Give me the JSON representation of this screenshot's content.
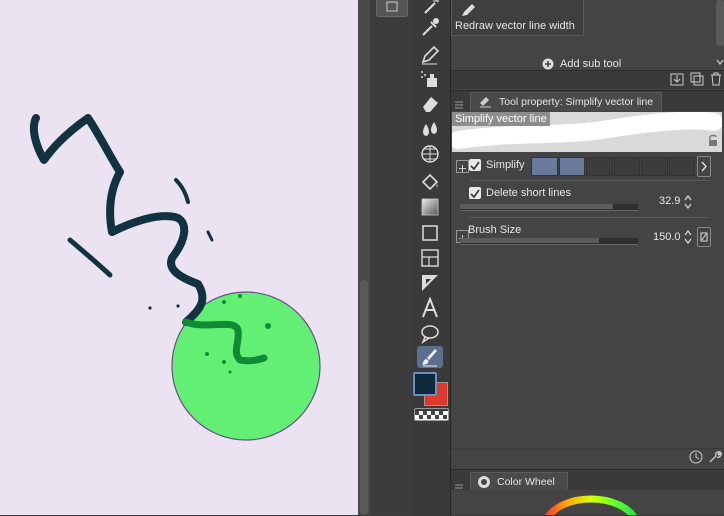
{
  "subtool": {
    "item_label": "Redraw vector line width",
    "add_label": "Add sub tool"
  },
  "tool_property": {
    "title": "Tool property: Simplify vector line",
    "preview_label": "Simplify vector line",
    "simplify": {
      "label": "Simplify",
      "segments_total": 6,
      "segments_filled": 2
    },
    "delete_short_lines": {
      "label": "Delete short lines",
      "value": "32.9",
      "checked": true
    },
    "brush_size": {
      "label": "Brush Size",
      "value": "150.0"
    }
  },
  "color_wheel": {
    "title": "Color Wheel"
  },
  "colors": {
    "main_color": "#0d2a3a",
    "sub_color": "#e03a2f",
    "accent": "#6a7a9c",
    "canvas_bg": "#ebe3f2",
    "circle_fill": "#63ef73"
  },
  "tools": [
    "magic-wand",
    "eyedropper",
    "pen",
    "spray",
    "eraser",
    "blend",
    "grid",
    "fill",
    "gradient",
    "figure",
    "frame",
    "ruler",
    "text",
    "balloon",
    "correct-line",
    "color-swatch",
    "transparent"
  ]
}
